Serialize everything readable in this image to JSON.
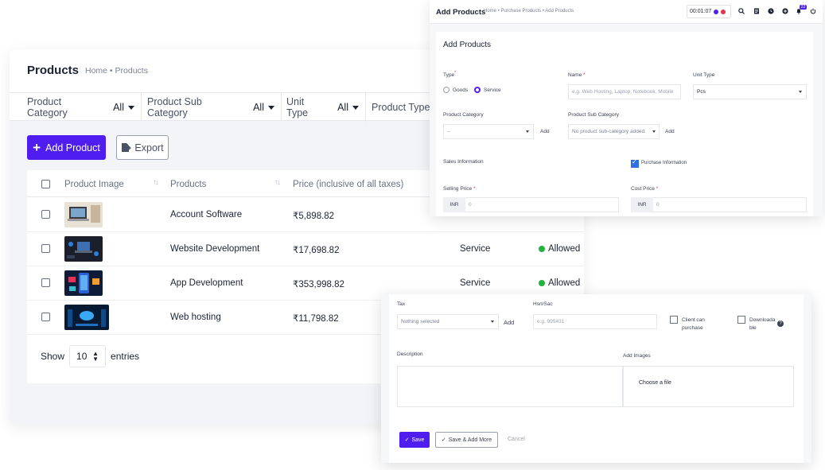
{
  "products": {
    "title": "Products",
    "breadcrumb": "Home • Products",
    "filters": [
      {
        "label": "Product Category",
        "value": "All"
      },
      {
        "label": "Product Sub Category",
        "value": "All"
      },
      {
        "label": "Unit Type",
        "value": "All"
      },
      {
        "label": "Product Type",
        "value": ""
      }
    ],
    "add_button": "Add Product",
    "export_button": "Export",
    "columns": [
      "Product Image",
      "Products",
      "Price (inclusive of all taxes)"
    ],
    "rows": [
      {
        "name": "Account Software",
        "price": "₹5,898.82",
        "type": "",
        "status": ""
      },
      {
        "name": "Website Development",
        "price": "₹17,698.82",
        "type": "Service",
        "status": "Allowed"
      },
      {
        "name": "App Development",
        "price": "₹353,998.82",
        "type": "Service",
        "status": "Allowed"
      },
      {
        "name": "Web hosting",
        "price": "₹11,798.82",
        "type": "",
        "status": ""
      }
    ],
    "show_label": "Show",
    "entries_value": "10",
    "entries_label": "entries"
  },
  "add_form": {
    "title": "Add Products",
    "breadcrumb": "Home • Purchase Products • Add Products",
    "timer": "00:01:07",
    "notification_count": "22",
    "card_title": "Add Products",
    "type_label": "Type",
    "type_options": [
      "Goods",
      "Service"
    ],
    "name_label": "Name",
    "name_placeholder": "e.g. Web Hosting, Laptop, Notebook, Mobile",
    "unit_type_label": "Unit Type",
    "unit_type_value": "Pcs",
    "product_category_label": "Product Category",
    "product_category_value": "--",
    "add_label": "Add",
    "product_sub_category_label": "Product Sub Category",
    "product_sub_category_value": "No product sub-category added.",
    "sales_info_label": "Sales Information",
    "purchase_info_label": "Purchase Information",
    "selling_price_label": "Selling Price",
    "cost_price_label": "Cost Price",
    "currency": "INR",
    "price_placeholder": "0"
  },
  "bottom_form": {
    "tax_label": "Tax",
    "tax_value": "Nothing selected",
    "add_label": "Add",
    "hsn_label": "Hsn/Sac",
    "hsn_placeholder": "e.g. 995431",
    "client_purchase_line1": "Client can",
    "client_purchase_line2": "purchase",
    "downloadable_line1": "Downloada",
    "downloadable_line2": "ble",
    "description_label": "Description",
    "add_images_label": "Add Images",
    "choose_file": "Choose a file",
    "save_button": "Save",
    "save_add_more_button": "Save & Add More",
    "cancel_button": "Cancel"
  },
  "colors": {
    "accent": "#4f1df0",
    "allowed": "#24b33f",
    "required": "#e0344d"
  }
}
